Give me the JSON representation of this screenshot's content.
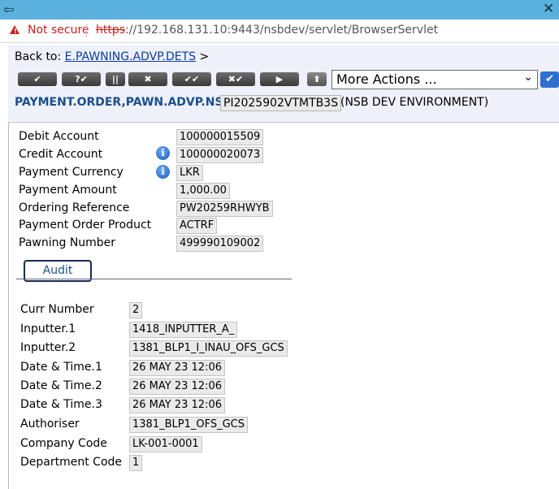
{
  "browser": {
    "security_label": "Not secure",
    "url_scheme": "https",
    "url_rest": "://192.168.131.10:9443/nsbdev/servlet/BrowserServlet"
  },
  "header": {
    "back_to_label": "Back to:",
    "back_to_link": "E.PAWNING.ADVP.DETS",
    "back_to_arrow": ">",
    "more_actions": "More Actions ...",
    "application": "PAYMENT.ORDER,PAWN.ADVP.NSB",
    "record_id": "PI2025902VTMTB3S",
    "environment": "(NSB DEV ENVIRONMENT)"
  },
  "toolbar": [
    {
      "name": "commit-button",
      "glyph": "✔"
    },
    {
      "name": "validate-button",
      "glyph": "?✔"
    },
    {
      "name": "hold-button",
      "glyph": "||"
    },
    {
      "name": "delete-button",
      "glyph": "✖"
    },
    {
      "name": "authorise-button",
      "glyph": "✔✔"
    },
    {
      "name": "reverse-button",
      "glyph": "✖✔"
    },
    {
      "name": "next-button",
      "glyph": "▶"
    }
  ],
  "main_fields": [
    {
      "label": "Debit Account",
      "value": "100000015509"
    },
    {
      "label": "Credit Account",
      "value": "100000020073"
    },
    {
      "label": "Payment Currency",
      "value": "LKR"
    },
    {
      "label": "Payment Amount",
      "value": "1,000.00"
    },
    {
      "label": "Ordering Reference",
      "value": "PW20259RHWYB"
    },
    {
      "label": "Payment Order Product",
      "value": "ACTRF"
    },
    {
      "label": "Pawning Number",
      "value": "499990109002"
    }
  ],
  "audit_tab": "Audit",
  "audit_fields": [
    {
      "label": "Curr Number",
      "value": "2"
    },
    {
      "label": "Inputter.1",
      "value": "1418_INPUTTER_A_"
    },
    {
      "label": "Inputter.2",
      "value": "1381_BLP1_I_INAU_OFS_GCS"
    },
    {
      "label": "Date & Time.1",
      "value": "26 MAY 23 12:06"
    },
    {
      "label": "Date & Time.2",
      "value": "26 MAY 23 12:06"
    },
    {
      "label": "Date & Time.3",
      "value": "26 MAY 23 12:06"
    },
    {
      "label": "Authoriser",
      "value": "1381_BLP1_OFS_GCS"
    },
    {
      "label": "Company Code",
      "value": "LK-001-0001"
    },
    {
      "label": "Department Code",
      "value": "1"
    }
  ]
}
